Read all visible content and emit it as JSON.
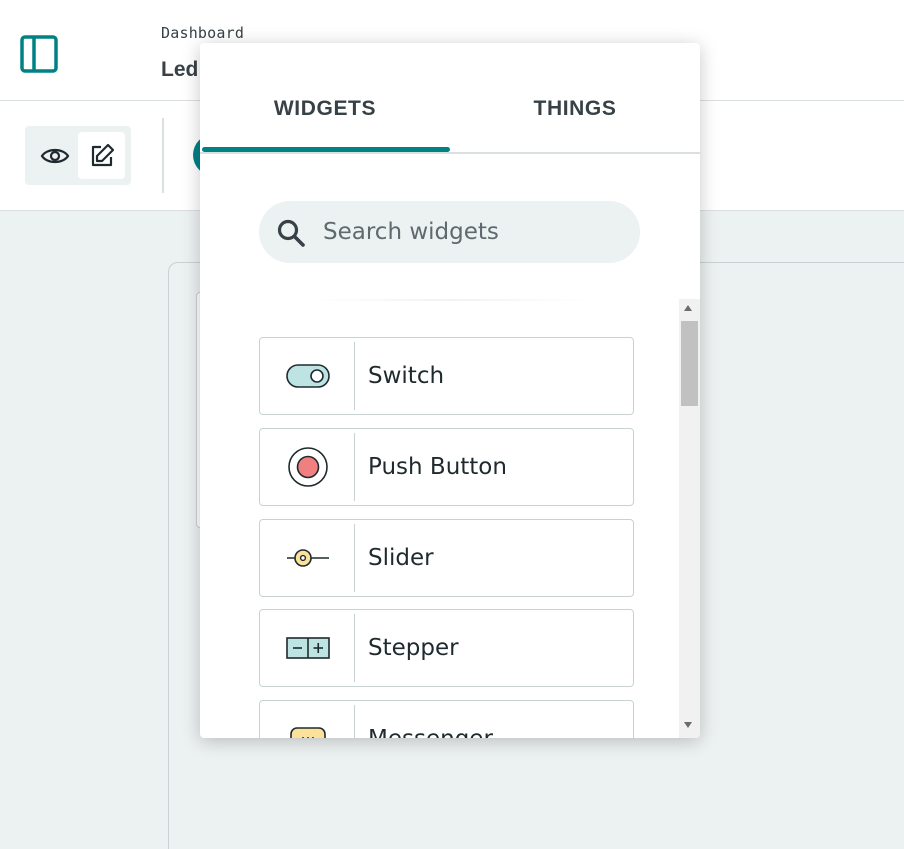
{
  "header": {
    "breadcrumb": "Dashboard",
    "title": "Led",
    "sidebar_toggle_icon": "sidebar-panel-icon"
  },
  "toolbar": {
    "view_icon": "eye-icon",
    "edit_icon": "edit-pencil-icon"
  },
  "popup": {
    "tabs": [
      {
        "label": "WIDGETS",
        "active": true
      },
      {
        "label": "THINGS",
        "active": false
      }
    ],
    "search": {
      "placeholder": "Search widgets",
      "value": ""
    },
    "widgets": [
      {
        "label": "Switch",
        "icon": "switch-icon"
      },
      {
        "label": "Push Button",
        "icon": "push-button-icon"
      },
      {
        "label": "Slider",
        "icon": "slider-icon"
      },
      {
        "label": "Stepper",
        "icon": "stepper-icon"
      },
      {
        "label": "Messenger",
        "icon": "messenger-icon"
      }
    ]
  },
  "colors": {
    "accent": "#008184",
    "background": "#ECF1F1",
    "text": "#374146",
    "switch_fill": "#BDE3E3",
    "button_fill": "#F08080",
    "slider_fill": "#FBE19A",
    "messenger_fill": "#FBE19A"
  }
}
